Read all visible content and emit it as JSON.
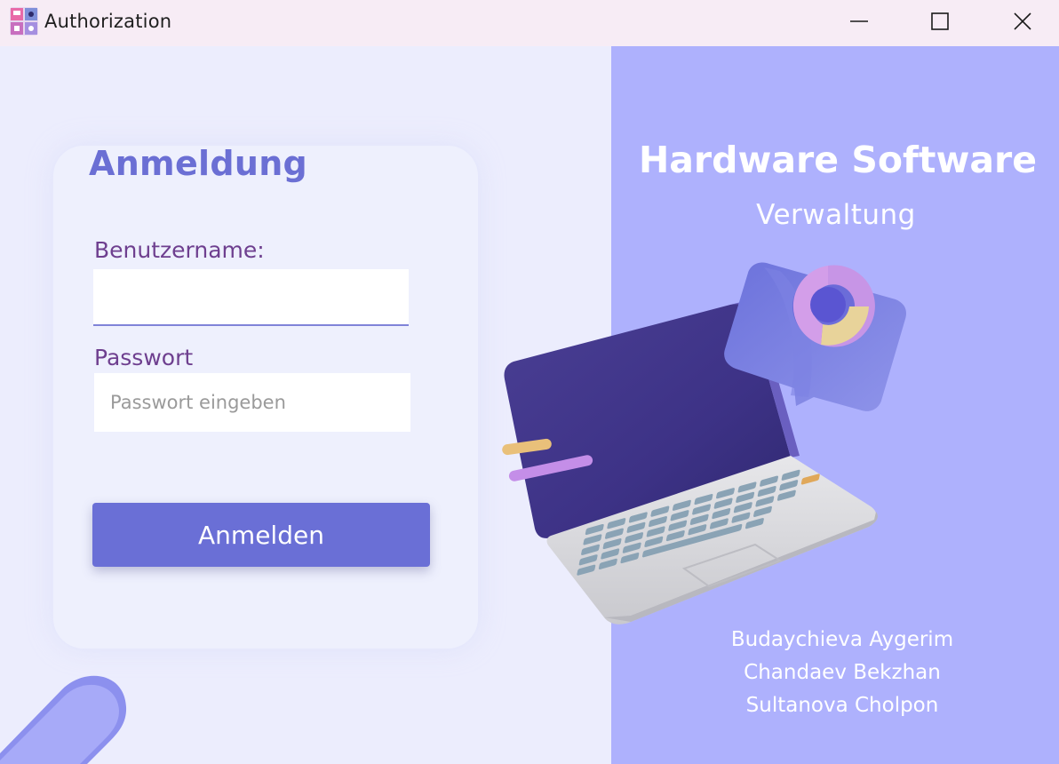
{
  "window": {
    "title": "Authorization",
    "controls": [
      "minimize-icon",
      "maximize-icon",
      "close-icon"
    ]
  },
  "login": {
    "title": "Anmeldung",
    "username_label": "Benutzername:",
    "username_value": "",
    "password_label": "Passwort",
    "password_placeholder": "Passwort eingeben",
    "button_label": "Anmelden"
  },
  "branding": {
    "title": "Hardware Software",
    "subtitle": "Verwaltung",
    "authors": [
      "Budaychieva Aygerim",
      "Chandaev Bekzhan",
      "Sultanova Cholpon"
    ]
  },
  "colors": {
    "accent": "#6a6fd6",
    "right_panel": "#aeb1fd",
    "left_panel": "#ecedfd",
    "label": "#6e3f8f",
    "title_bar": "#f7ecf5"
  }
}
